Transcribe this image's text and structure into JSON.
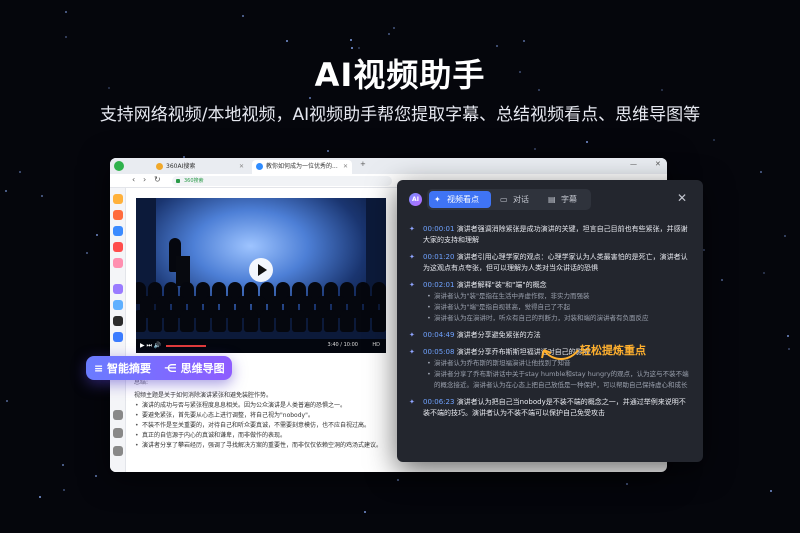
{
  "hero": {
    "title": "AI视频助手",
    "subtitle": "支持网络视频/本地视频，AI视频助手帮您提取字幕、总结视频看点、思维导图等"
  },
  "browser": {
    "tabs": [
      {
        "label": "360AI搜索"
      },
      {
        "label": "教你如何成为一位优秀的..."
      }
    ],
    "url_label": "360搜索",
    "video": {
      "time": "3:40 / 10:00",
      "quality": "HD"
    },
    "summary": {
      "heading": "总结:",
      "intro": "视频主题是关于如何消除演讲紧张和避免装腔作势。",
      "items": [
        "演讲的成功与否与紧张程度息息相关。因为公众演讲是人类普遍的恐惧之一。",
        "要避免紧张，首先要从心态上进行调整，将自己视为\"nobody\"。",
        "不装不作是至关重要的，对待自己和听众要真诚，不需要刻意模仿，也不应自视过高。",
        "真正的自信源于内心的真诚和谦卑，而非做作的表现。",
        "演讲者分享了攀岩经历，强调了寻找解决方案的重要性，而非仅仅依赖空洞的鸡汤式建议。"
      ]
    }
  },
  "pills": {
    "summary_label": "智能摘要",
    "mindmap_label": "思维导图"
  },
  "panel": {
    "badge": "AI",
    "tabs": [
      {
        "label": "视频看点",
        "icon": "sparkle-icon",
        "active": true
      },
      {
        "label": "对话",
        "icon": "chat-icon",
        "active": false
      },
      {
        "label": "字幕",
        "icon": "subtitle-icon",
        "active": false
      }
    ],
    "close_label": "✕",
    "entries": [
      {
        "ts": "00:00:01",
        "text": "演讲者强调消除紧张是成功演讲的关键，坦言自己目前也有些紧张，并感谢大家的支持和理解",
        "bullets": []
      },
      {
        "ts": "00:01:20",
        "text": "演讲者引用心理学家的观点：心理学家认为人类最害怕的是死亡，演讲者认为这观点有点夸张，但可以理解为人类对当众讲话的恐惧",
        "bullets": []
      },
      {
        "ts": "00:02:01",
        "text": "演讲者解释\"装\"和\"端\"的概念",
        "bullets": [
          "演讲者认为\"装\"是指在生活中弄虚作假，非实力而强装",
          "演讲者认为\"端\"是指自视甚高，觉得自己了不起",
          "演讲者认为在演讲时，听众有自己的判断力，对装和端的演讲者有负面反应"
        ]
      },
      {
        "ts": "00:04:49",
        "text": "演讲者分享避免紧张的方法",
        "bullets": []
      },
      {
        "ts": "00:05:08",
        "text": "演讲者分享乔布斯斯坦福讲话对自己的影响",
        "bullets": [
          "演讲者认为乔布斯的斯坦福演讲让他找到了知音",
          "演讲者分享了乔布斯讲话中关于stay humble和stay hungry的观点，认为这与不装不端的概念接近。演讲者认为在心态上把自己放低是一种保护，可以帮助自己保持虚心和成长"
        ]
      },
      {
        "ts": "00:06:23",
        "text": "演讲者认为把自己当nobody是不装不端的概念之一，并通过举例来说明不装不端的技巧。演讲者认为不装不端可以保护自己免受攻击",
        "bullets": []
      }
    ]
  },
  "callout": "轻松提炼重点",
  "colors": {
    "accent": "#3f74f5",
    "highlight": "#ffb02e",
    "panel_bg": "#23262e"
  }
}
